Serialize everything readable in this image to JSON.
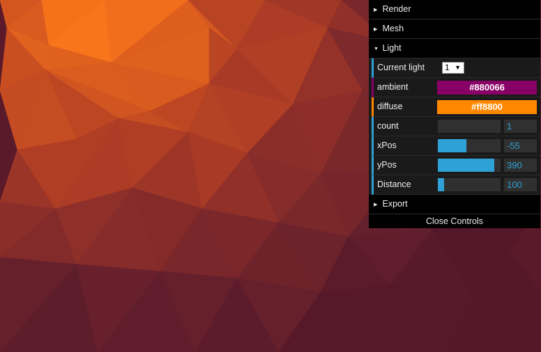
{
  "background": {
    "colors": [
      "#ff7a1a",
      "#e0601e",
      "#c24a22",
      "#a83a26",
      "#8c2e2a",
      "#74252b",
      "#621f2c",
      "#55182a"
    ]
  },
  "panel": {
    "folders": {
      "render": {
        "label": "Render",
        "icon": "triangle-right-icon"
      },
      "mesh": {
        "label": "Mesh",
        "icon": "triangle-right-icon"
      },
      "light": {
        "label": "Light",
        "icon": "triangle-down-icon"
      },
      "export": {
        "label": "Export",
        "icon": "triangle-right-icon"
      }
    },
    "light": {
      "current_light": {
        "label": "Current light",
        "value": "1"
      },
      "ambient": {
        "label": "ambient",
        "value": "#880066",
        "color": "#880066"
      },
      "diffuse": {
        "label": "diffuse",
        "value": "#ff8800",
        "color": "#ff8800"
      },
      "count": {
        "label": "count",
        "value": "1",
        "fraction": 0.0
      },
      "xPos": {
        "label": "xPos",
        "value": "-55",
        "fraction": 0.45
      },
      "yPos": {
        "label": "yPos",
        "value": "390",
        "fraction": 0.9
      },
      "distance": {
        "label": "Distance",
        "value": "100",
        "fraction": 0.1
      }
    },
    "close_label": "Close Controls"
  }
}
